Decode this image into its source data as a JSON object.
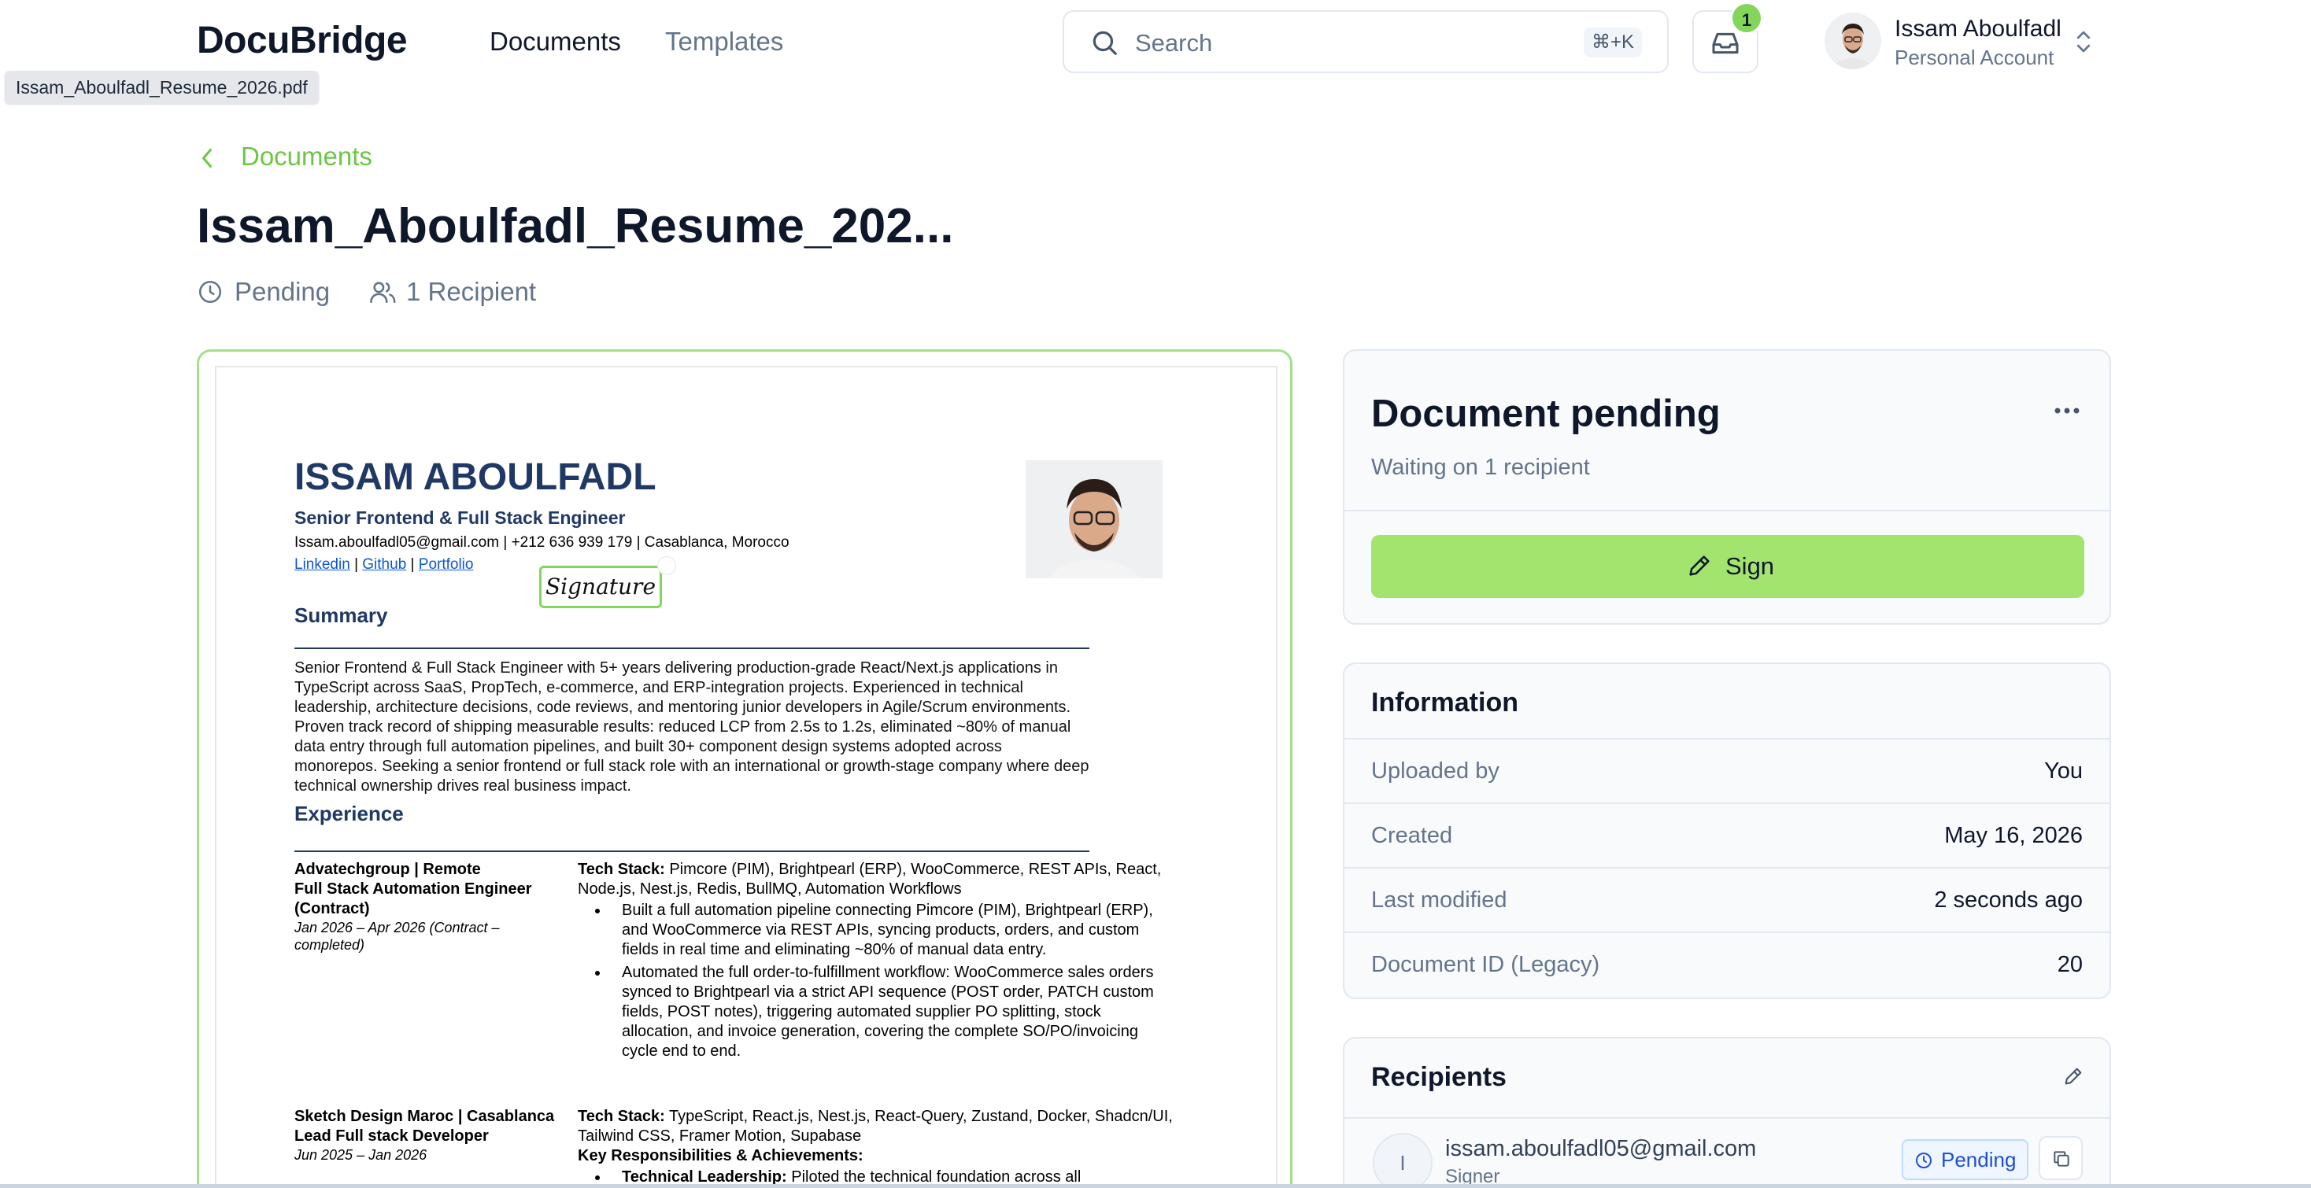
{
  "app": {
    "logo": "DocuBridge"
  },
  "nav": {
    "documents": "Documents",
    "templates": "Templates"
  },
  "tooltip": "Issam_Aboulfadl_Resume_2026.pdf",
  "search": {
    "placeholder": "Search",
    "shortcut": "⌘+K"
  },
  "inbox": {
    "count": "1"
  },
  "user": {
    "name": "Issam Aboulfadl",
    "account": "Personal Account"
  },
  "breadcrumb": {
    "back_label": "Documents"
  },
  "document": {
    "title": "Issam_Aboulfadl_Resume_202...",
    "status": "Pending",
    "recipients": "1 Recipient"
  },
  "resume": {
    "name": "ISSAM ABOULFADL",
    "role": "Senior Frontend & Full Stack Engineer",
    "contact": "Issam.aboulfadl05@gmail.com  | +212 636 939 179 | Casablanca, Morocco",
    "link_linkedin": "Linkedin",
    "link_github": "Github",
    "link_portfolio": "Portfolio",
    "sep": "|",
    "signature_label": "Signature",
    "summary_heading": "Summary",
    "summary_text": "Senior Frontend & Full Stack Engineer with 5+ years delivering production-grade React/Next.js applications in TypeScript across SaaS, PropTech, e-commerce, and ERP-integration projects. Experienced in technical leadership, architecture decisions, code reviews, and mentoring junior developers in Agile/Scrum environments. Proven track record of shipping measurable results: reduced LCP from 2.5s to 1.2s, eliminated ~80% of manual data entry through full automation pipelines, and built 30+ component design systems adopted across monorepos. Seeking a senior frontend or full stack role with an international or growth-stage company where deep technical ownership drives real business impact.",
    "experience_heading": "Experience",
    "job1": {
      "company": "Advatechgroup  |  Remote",
      "title": "Full Stack Automation Engineer (Contract)",
      "dates": "Jan 2026 – Apr 2026  (Contract – completed)",
      "stack_label": "Tech Stack:",
      "stack": "Pimcore (PIM), Brightpearl (ERP), WooCommerce, REST APIs, React, Node.js, Nest.js, Redis, BullMQ, Automation Workflows",
      "bullet1": "Built a full automation pipeline connecting Pimcore (PIM), Brightpearl (ERP), and WooCommerce via REST APIs, syncing products, orders, and custom fields in real time and eliminating ~80% of manual data entry.",
      "bullet2": "Automated the full order-to-fulfillment workflow: WooCommerce sales orders synced to Brightpearl via a strict API sequence (POST order, PATCH custom fields, POST notes), triggering automated supplier PO splitting, stock allocation, and invoice generation, covering the complete SO/PO/invoicing cycle end to end."
    },
    "job2": {
      "company": "Sketch Design Maroc  |  Casablanca",
      "title": "Lead Full stack Developer",
      "dates": "Jun 2025 – Jan 2026",
      "stack_label": "Tech Stack:",
      "stack": "TypeScript, React.js, Nest.js, React-Query, Zustand, Docker, Shadcn/UI, Tailwind CSS, Framer Motion, Supabase",
      "resp_label": "Key Responsibilities & Achievements:",
      "bullet1_label": "Technical Leadership:",
      "bullet1": "Piloted the technical foundation across all"
    }
  },
  "status_card": {
    "title": "Document pending",
    "subtitle": "Waiting on 1 recipient",
    "sign_label": "Sign"
  },
  "info": {
    "title": "Information",
    "rows": [
      {
        "label": "Uploaded by",
        "value": "You"
      },
      {
        "label": "Created",
        "value": "May 16, 2026"
      },
      {
        "label": "Last modified",
        "value": "2 seconds ago"
      },
      {
        "label": "Document ID (Legacy)",
        "value": "20"
      }
    ]
  },
  "recipients": {
    "title": "Recipients",
    "items": [
      {
        "initial": "I",
        "email": "issam.aboulfadl05@gmail.com",
        "role": "Signer",
        "status": "Pending"
      }
    ]
  },
  "colors": {
    "accent": "#84d65a",
    "sign_button": "#a3e46e",
    "pending_blue": "#1d4ed8"
  }
}
